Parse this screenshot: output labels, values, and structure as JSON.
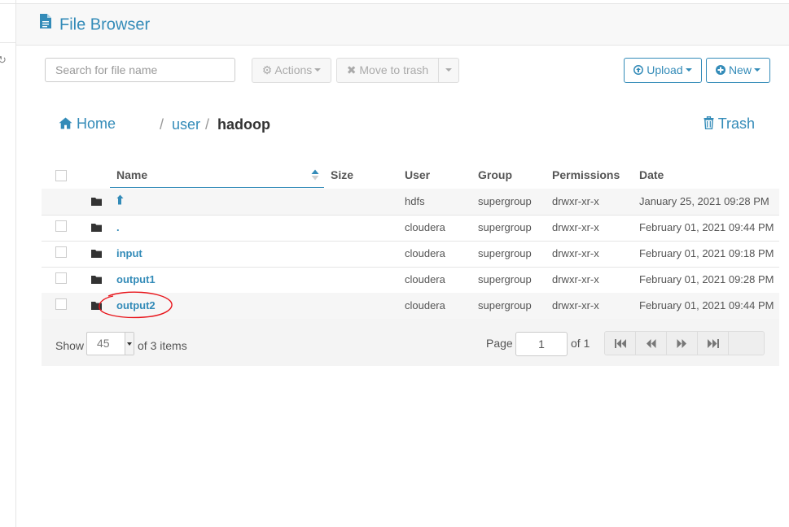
{
  "header": {
    "title": "File Browser"
  },
  "toolbar": {
    "search_placeholder": "Search for file name",
    "actions_label": "Actions",
    "move_to_trash_label": "Move to trash",
    "upload_label": "Upload",
    "new_label": "New"
  },
  "breadcrumb": {
    "home_label": "Home",
    "separator": "/",
    "path": [
      "user",
      "hadoop"
    ],
    "trash_label": "Trash"
  },
  "table": {
    "columns": {
      "name": "Name",
      "size": "Size",
      "user": "User",
      "group": "Group",
      "permissions": "Permissions",
      "date": "Date"
    },
    "sort": {
      "column": "Name",
      "direction": "ascending"
    },
    "rows": [
      {
        "name": "",
        "icon": "parent-directory-icon",
        "size": "",
        "user": "hdfs",
        "group": "supergroup",
        "permissions": "drwxr-xr-x",
        "date": "January 25, 2021 09:28 PM"
      },
      {
        "name": ".",
        "size": "",
        "user": "cloudera",
        "group": "supergroup",
        "permissions": "drwxr-xr-x",
        "date": "February 01, 2021 09:44 PM"
      },
      {
        "name": "input",
        "size": "",
        "user": "cloudera",
        "group": "supergroup",
        "permissions": "drwxr-xr-x",
        "date": "February 01, 2021 09:18 PM"
      },
      {
        "name": "output1",
        "size": "",
        "user": "cloudera",
        "group": "supergroup",
        "permissions": "drwxr-xr-x",
        "date": "February 01, 2021 09:28 PM"
      },
      {
        "name": "output2",
        "size": "",
        "user": "cloudera",
        "group": "supergroup",
        "permissions": "drwxr-xr-x",
        "date": "February 01, 2021 09:44 PM"
      }
    ]
  },
  "footer": {
    "show_label": "Show",
    "page_size": "45",
    "items_label": "of 3 items",
    "page_label": "Page",
    "page_value": "1",
    "of_pages": "of 1"
  },
  "colors": {
    "accent": "#338bb8",
    "annotation": "#e8151b"
  }
}
